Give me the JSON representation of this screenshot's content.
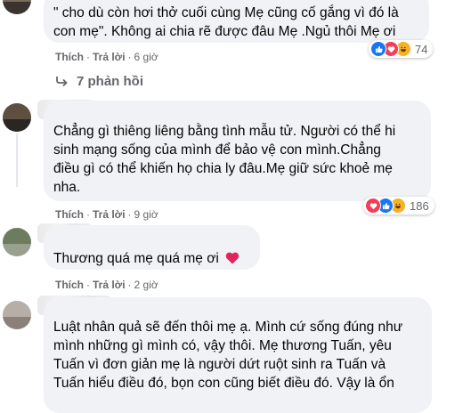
{
  "comment1": {
    "text_line1": "\" cho dù còn hơi thở cuối cùng Mẹ cũng cố gắng vì đó là",
    "text_line2": "con mẹ\". Không ai chia rẽ được đâu Mẹ .Ngủ thôi Mẹ ơi",
    "like_label": "Thích",
    "reply_label": "Trả lời",
    "time": "6 giờ",
    "reaction_count": "74",
    "reaction_icons": [
      "like-icon",
      "love-icon",
      "haha-icon"
    ]
  },
  "replies_toggle": {
    "label": "7 phản hồi",
    "icon": "reply-arrow-icon"
  },
  "comment2": {
    "text_line1": "Chẳng gì thiêng liêng bằng tình mẫu tử. Người có thể hi",
    "text_line2": "sinh mạng sống của mình để bảo vệ con mình.Chẳng",
    "text_line3": "điều gì có thể khiến họ chia ly đâu.Mẹ giữ sức khoẻ mẹ",
    "text_line4": "nha.",
    "like_label": "Thích",
    "reply_label": "Trả lời",
    "time": "9 giờ",
    "reaction_count": "186",
    "reaction_icons": [
      "love-icon",
      "like-icon",
      "haha-icon"
    ]
  },
  "comment3": {
    "text": "Thương quá mẹ quá mẹ ơi",
    "emoji": "❤️",
    "like_label": "Thích",
    "reply_label": "Trả lời",
    "time": "2 giờ"
  },
  "comment4": {
    "text_line1": "Luật nhân quả sẽ đến thôi mẹ ạ. Mình cứ sống đúng như",
    "text_line2": "mình những gì mình có, vậy thôi. Mẹ thương Tuấn, yêu",
    "text_line3": "Tuấn vì đơn giản mẹ là người dứt ruột sinh ra Tuấn và",
    "text_line4": "Tuấn hiểu điều đó, bọn con cũng biết điều đó. Vậy là ổn"
  },
  "colors": {
    "bubble_bg": "#f0f2f5",
    "meta_text": "#65676b",
    "like_blue": "#1877f2",
    "love_red": "#f33e58",
    "haha_yellow": "#f7b125"
  }
}
